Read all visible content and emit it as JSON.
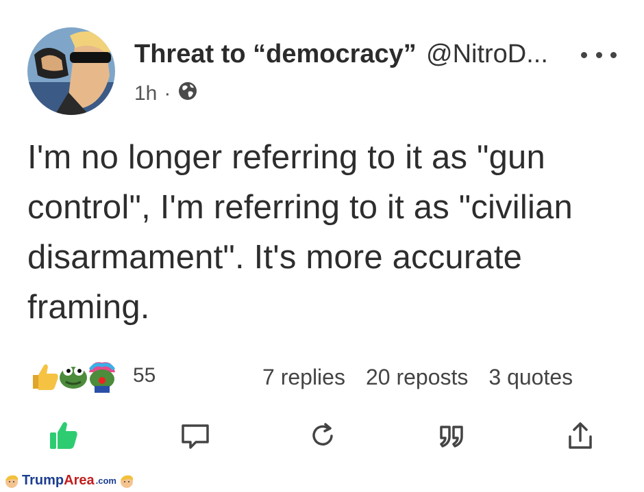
{
  "post": {
    "author_name": "Threat to “democracy”",
    "handle": "@NitroD...",
    "time": "1h",
    "separator": "·",
    "text": "I'm no longer referring to it as \"gun control\", I'm referring to it as \"civilian disarmament\". It's more accurate framing."
  },
  "icons": {
    "avatar": "avatar",
    "more": "more-options-icon",
    "visibility": "globe-icon",
    "like": "thumbs-up-icon",
    "reply": "reply-icon",
    "repost": "repost-icon",
    "quote": "quote-icon",
    "share": "share-icon"
  },
  "stats": {
    "reaction_count": "55",
    "replies": "7 replies",
    "reposts": "20 reposts",
    "quotes": "3 quotes"
  },
  "colors": {
    "like_active": "#2ecc71",
    "text": "#2d2d2d",
    "action_icon": "#444444"
  },
  "watermark": {
    "brand_part1": "Trump",
    "brand_part2": "Area",
    "brand_suffix": ".com"
  }
}
